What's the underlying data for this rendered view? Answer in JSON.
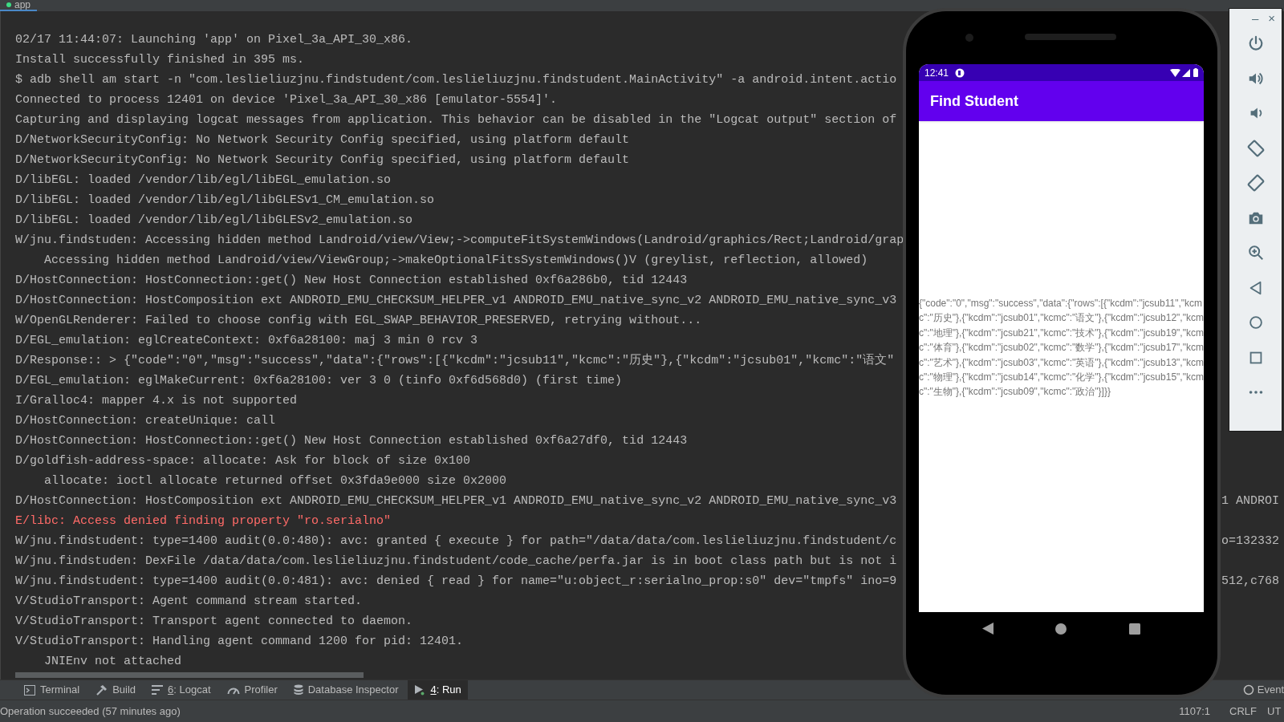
{
  "editor_tab": {
    "label": "app"
  },
  "log_lines": [
    {
      "text": "02/17 11:44:07: Launching 'app' on Pixel_3a_API_30_x86.",
      "kind": "info"
    },
    {
      "text": "Install successfully finished in 395 ms.",
      "kind": "info"
    },
    {
      "text": "$ adb shell am start -n \"com.leslieliuzjnu.findstudent/com.leslieliuzjnu.findstudent.MainActivity\" -a android.intent.actio",
      "kind": "info"
    },
    {
      "text": "Connected to process 12401 on device 'Pixel_3a_API_30_x86 [emulator-5554]'.",
      "kind": "info"
    },
    {
      "text": "Capturing and displaying logcat messages from application. This behavior can be disabled in the \"Logcat output\" section of",
      "kind": "info"
    },
    {
      "text": "D/NetworkSecurityConfig: No Network Security Config specified, using platform default",
      "kind": "info"
    },
    {
      "text": "D/NetworkSecurityConfig: No Network Security Config specified, using platform default",
      "kind": "info"
    },
    {
      "text": "D/libEGL: loaded /vendor/lib/egl/libEGL_emulation.so",
      "kind": "info"
    },
    {
      "text": "D/libEGL: loaded /vendor/lib/egl/libGLESv1_CM_emulation.so",
      "kind": "info"
    },
    {
      "text": "D/libEGL: loaded /vendor/lib/egl/libGLESv2_emulation.so",
      "kind": "info"
    },
    {
      "text": "W/jnu.findstuden: Accessing hidden method Landroid/view/View;->computeFitSystemWindows(Landroid/graphics/Rect;Landroid/grap",
      "kind": "info"
    },
    {
      "text": "    Accessing hidden method Landroid/view/ViewGroup;->makeOptionalFitsSystemWindows()V (greylist, reflection, allowed)",
      "kind": "info"
    },
    {
      "text": "D/HostConnection: HostConnection::get() New Host Connection established 0xf6a286b0, tid 12443",
      "kind": "info"
    },
    {
      "text": "D/HostConnection: HostComposition ext ANDROID_EMU_CHECKSUM_HELPER_v1 ANDROID_EMU_native_sync_v2 ANDROID_EMU_native_sync_v3",
      "kind": "info"
    },
    {
      "text": "W/OpenGLRenderer: Failed to choose config with EGL_SWAP_BEHAVIOR_PRESERVED, retrying without...",
      "kind": "info"
    },
    {
      "text": "D/EGL_emulation: eglCreateContext: 0xf6a28100: maj 3 min 0 rcv 3",
      "kind": "info"
    },
    {
      "text": "D/Response:: > {\"code\":\"0\",\"msg\":\"success\",\"data\":{\"rows\":[{\"kcdm\":\"jcsub11\",\"kcmc\":\"历史\"},{\"kcdm\":\"jcsub01\",\"kcmc\":\"语文\"",
      "kind": "info"
    },
    {
      "text": "D/EGL_emulation: eglMakeCurrent: 0xf6a28100: ver 3 0 (tinfo 0xf6d568d0) (first time)",
      "kind": "info"
    },
    {
      "text": "I/Gralloc4: mapper 4.x is not supported",
      "kind": "info"
    },
    {
      "text": "D/HostConnection: createUnique: call",
      "kind": "info"
    },
    {
      "text": "D/HostConnection: HostConnection::get() New Host Connection established 0xf6a27df0, tid 12443",
      "kind": "info"
    },
    {
      "text": "D/goldfish-address-space: allocate: Ask for block of size 0x100",
      "kind": "info"
    },
    {
      "text": "    allocate: ioctl allocate returned offset 0x3fda9e000 size 0x2000",
      "kind": "info"
    },
    {
      "text": "D/HostConnection: HostComposition ext ANDROID_EMU_CHECKSUM_HELPER_v1 ANDROID_EMU_native_sync_v2 ANDROID_EMU_native_sync_v3",
      "kind": "info",
      "tail": "1 ANDROI"
    },
    {
      "text": "E/libc: Access denied finding property \"ro.serialno\"",
      "kind": "error"
    },
    {
      "text": "W/jnu.findstudent: type=1400 audit(0.0:480): avc: granted { execute } for path=\"/data/data/com.leslieliuzjnu.findstudent/c",
      "kind": "info",
      "tail": "o=132332"
    },
    {
      "text": "W/jnu.findstuden: DexFile /data/data/com.leslieliuzjnu.findstudent/code_cache/perfa.jar is in boot class path but is not i",
      "kind": "info"
    },
    {
      "text": "W/jnu.findstudent: type=1400 audit(0.0:481): avc: denied { read } for name=\"u:object_r:serialno_prop:s0\" dev=\"tmpfs\" ino=9",
      "kind": "info",
      "tail": "512,c768"
    },
    {
      "text": "V/StudioTransport: Agent command stream started.",
      "kind": "info"
    },
    {
      "text": "V/StudioTransport: Transport agent connected to daemon.",
      "kind": "info"
    },
    {
      "text": "V/StudioTransport: Handling agent command 1200 for pid: 12401.",
      "kind": "info"
    },
    {
      "text": "    JNIEnv not attached",
      "kind": "info"
    }
  ],
  "phone": {
    "time": "12:41",
    "app_title": "Find Student",
    "body_text": "{\"code\":\"0\",\"msg\":\"success\",\"data\":{\"rows\":[{\"kcdm\":\"jcsub11\",\"kcmc\":\"历史\"},{\"kcdm\":\"jcsub01\",\"kcmc\":\"语文\"},{\"kcdm\":\"jcsub12\",\"kcmc\":\"地理\"},{\"kcdm\":\"jcsub21\",\"kcmc\":\"技术\"},{\"kcdm\":\"jcsub19\",\"kcmc\":\"体育\"},{\"kcdm\":\"jcsub02\",\"kcmc\":\"数学\"},{\"kcdm\":\"jcsub17\",\"kcmc\":\"艺术\"},{\"kcdm\":\"jcsub03\",\"kcmc\":\"英语\"},{\"kcdm\":\"jcsub13\",\"kcmc\":\"物理\"},{\"kcdm\":\"jcsub14\",\"kcmc\":\"化学\"},{\"kcdm\":\"jcsub15\",\"kcmc\":\"生物\"},{\"kcdm\":\"jcsub09\",\"kcmc\":\"政治\"}]}}"
  },
  "emulator_panel": {
    "minimize": "–",
    "close": "×"
  },
  "tool_windows": [
    {
      "kind": "terminal",
      "label": "Terminal",
      "selected": false
    },
    {
      "kind": "build",
      "label": "Build",
      "selected": false
    },
    {
      "kind": "logcat",
      "key": "6",
      "label": ": Logcat",
      "selected": false
    },
    {
      "kind": "profiler",
      "label": "Profiler",
      "selected": false
    },
    {
      "kind": "database",
      "label": "Database Inspector",
      "selected": false
    },
    {
      "kind": "run",
      "key": "4",
      "label": ": Run",
      "selected": true
    }
  ],
  "event_log": {
    "label": "Event"
  },
  "status_bar": {
    "message": "Operation succeeded (57 minutes ago)",
    "position": "1107:1",
    "line_separator": "CRLF",
    "encoding": "UT"
  }
}
